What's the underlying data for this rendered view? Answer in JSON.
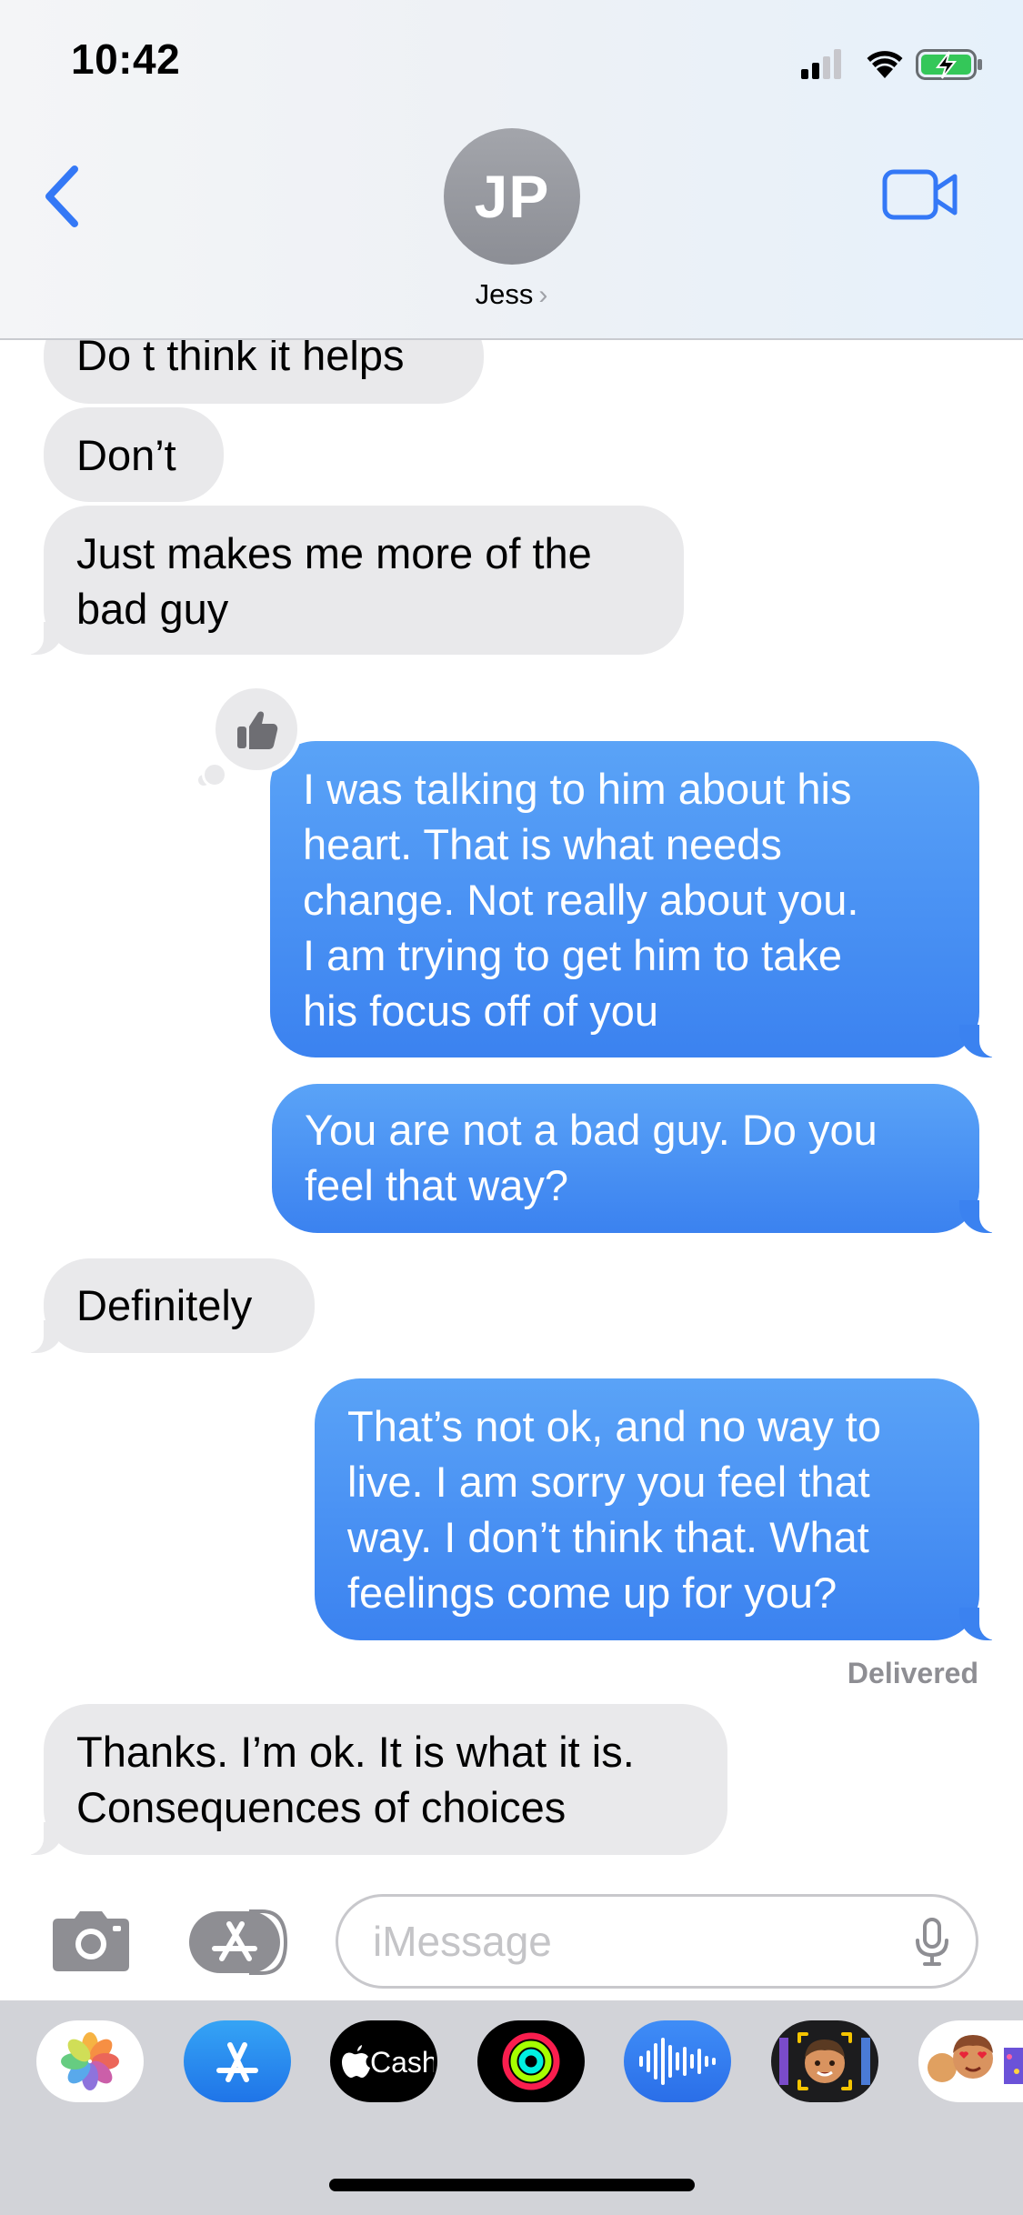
{
  "status_bar": {
    "time": "10:42",
    "signal_icon": "cellular-signal-icon",
    "wifi_icon": "wifi-icon",
    "battery_icon": "battery-charging-icon",
    "battery_color": "#34c759"
  },
  "header": {
    "back_icon": "chevron-left-icon",
    "avatar_initials": "JP",
    "contact_name": "Jess",
    "contact_chevron": "›",
    "video_icon": "video-camera-icon",
    "accent_color": "#3478f6"
  },
  "messages": [
    {
      "direction": "incoming",
      "lines": [
        "Do t think it helps"
      ]
    },
    {
      "direction": "incoming",
      "lines": [
        "Don’t"
      ]
    },
    {
      "direction": "incoming",
      "lines": [
        "Just makes me more of the",
        "bad guy"
      ]
    },
    {
      "direction": "outgoing",
      "lines": [
        "I was talking to him about his",
        "heart.  That is what needs",
        "change.  Not really about you.",
        "I am trying to get him to take",
        "his focus off of you"
      ],
      "tapback": "thumbs-up-icon"
    },
    {
      "direction": "outgoing",
      "lines": [
        "You are not a bad guy.  Do you",
        "feel that way?"
      ]
    },
    {
      "direction": "incoming",
      "lines": [
        "Definitely"
      ]
    },
    {
      "direction": "outgoing",
      "lines": [
        "That’s not ok, and no way to",
        "live.  I am sorry you feel that",
        "way. I don’t think that.  What",
        "feelings come up for you?"
      ]
    },
    {
      "direction": "incoming",
      "lines": [
        "Thanks. I’m ok. It is what it is.",
        "Consequences of choices"
      ]
    }
  ],
  "delivered_label": "Delivered",
  "input_bar": {
    "camera_icon": "camera-icon",
    "apps_icon": "app-store-icon",
    "placeholder": "iMessage",
    "mic_icon": "microphone-icon"
  },
  "app_drawer": {
    "apps": [
      {
        "name": "photos-app-icon"
      },
      {
        "name": "app-store-app-icon"
      },
      {
        "name": "apple-cash-app-icon",
        "label": "Cash"
      },
      {
        "name": "activity-app-icon"
      },
      {
        "name": "audio-message-app-icon"
      },
      {
        "name": "memoji-app-icon"
      },
      {
        "name": "memoji-stickers-app-icon"
      }
    ]
  }
}
